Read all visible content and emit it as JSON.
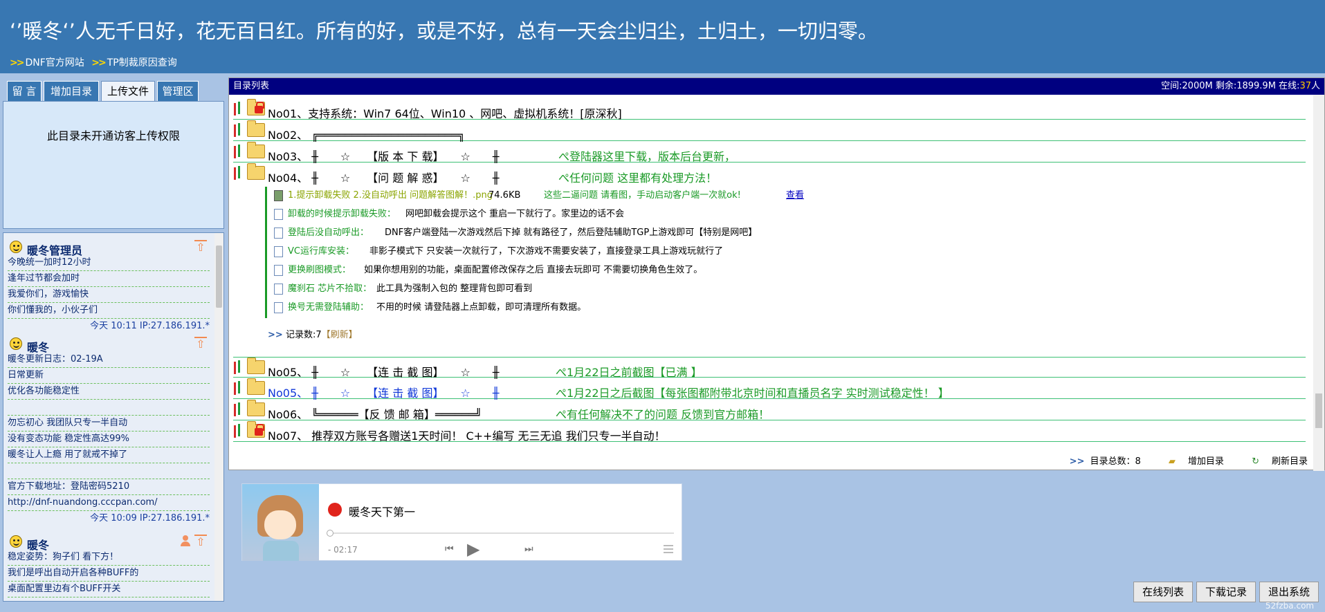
{
  "header": {
    "title": "‘’暖冬‘’人无千日好，花无百日红。所有的好，或是不好，总有一天会尘归尘，土归土，一切归零。",
    "links": [
      ">>DNF官方网站",
      ">>TP制裁原因查询"
    ],
    "link_labels": [
      "DNF官方网站",
      "TP制裁原因查询"
    ],
    "link_arrow": ">>"
  },
  "tabs": [
    "留 言",
    "增加目录",
    "上传文件",
    "管理区"
  ],
  "active_tab": "上传文件",
  "upload": {
    "message": "此目录未开通访客上传权限"
  },
  "messages": [
    {
      "name": "暖冬管理员",
      "lines": [
        "今晚统一加时12小时",
        "逢年过节都会加时",
        "我爱你们，游戏愉快",
        "你们懂我的，小伙子们"
      ],
      "time": "今天 10:11 IP:27.186.191.*"
    },
    {
      "name": "暖冬",
      "lines": [
        "暖冬更新日志：02-19A",
        "日常更新",
        "优化各功能稳定性",
        "",
        "勿忘初心 我团队只专一半自动",
        "没有变态功能 稳定性高达99%",
        "暖冬让人上瘾 用了就戒不掉了",
        "",
        "官方下载地址：登陆密码5210",
        "http://dnf-nuandong.cccpan.com/"
      ],
      "time": "今天 10:09 IP:27.186.191.*"
    },
    {
      "name": "暖冬",
      "lines": [
        "稳定姿势：狗子们 看下方！",
        "我们是呼出自动开启各种BUFF的",
        "桌面配置里边有个BUFF开关"
      ],
      "time": ""
    }
  ],
  "directory": {
    "title": "目录列表",
    "stat_prefix": "空间:2000M 剩余:1899.9M 在线:",
    "online": "37",
    "stat_suffix": "人",
    "rows": [
      {
        "label": "No01、支持系统：Win7 64位、Win10 、网吧、虚拟机系统！[原深秋]",
        "desc": "",
        "locked": true
      },
      {
        "label": "No02、 ╔═════════════════════╗",
        "desc": "",
        "locked": false
      },
      {
        "label": "No03、 ╫　　☆　　【版 本 下 载】　　☆　　╫",
        "desc": "ぺ登陆器这里下载，版本后台更新，",
        "locked": false
      },
      {
        "label": "No04、 ╫　　☆　　【问 题 解 惑】　　☆　　╫",
        "desc": "ぺ任何问题 这里都有处理方法！",
        "locked": false
      },
      {
        "label": "No05、 ╫　　☆　　【连 击 截 图】　　☆　　╫",
        "desc": "ぺ1月22日之前截图【已满 】",
        "locked": false
      },
      {
        "label": "No05、 ╫　　☆　　【连 击 截 图】　　☆　　╫",
        "desc": "ぺ1月22日之后截图【每张图都附带北京时间和直播员名字 实时测试稳定性！ 】",
        "locked": false
      },
      {
        "label": "No06、 ╚══════【反 馈 邮 箱】══════╝",
        "desc": "ぺ有任何解决不了的问题 反馈到官方邮箱！",
        "locked": false
      },
      {
        "label": "No07、 推荐双方账号各赠送1天时间！ C++编写 无三无追 我们只专一半自动！",
        "desc": "",
        "locked": true
      }
    ],
    "files": [
      {
        "name": "1.提示卸载失败 2.没自动呼出 问题解答图解！.png",
        "size": "74.6KB",
        "desc": "这些二逼问题 请看图，手动启动客户端一次就ok!",
        "view": "查看"
      },
      {
        "name": "卸载的时候提示卸载失败：",
        "desc": "网吧卸载会提示这个 重启一下就行了。家里边的话不会"
      },
      {
        "name": "登陆后没自动呼出：",
        "desc": "DNF客户端登陆一次游戏然后下掉 就有路径了，然后登陆辅助TGP上游戏即可【特别是网吧】"
      },
      {
        "name": "VC运行库安装：",
        "desc": "非影子模式下 只安装一次就行了，下次游戏不需要安装了，直接登录工具上游戏玩就行了"
      },
      {
        "name": "更换刷图模式：",
        "desc": "如果你想用别的功能，桌面配置修改保存之后 直接去玩即可 不需要切换角色生效了。"
      },
      {
        "name": "魔刹石 芯片不拾取：",
        "desc": "此工具为强制入包的 整理背包即可看到"
      },
      {
        "name": "换号无需登陆辅助：",
        "desc": "不用的时候 请登陆器上点卸载，即可清理所有数据。"
      }
    ],
    "record_label": "记录数:7",
    "refresh_label": "【刷新】",
    "total_label": "目录总数：8",
    "add_label": "增加目录",
    "refresh_dir_label": "刷新目录"
  },
  "player": {
    "song": "暖冬天下第一",
    "time": "- 02:17"
  },
  "buttons": [
    "在线列表",
    "下载记录",
    "退出系统"
  ],
  "watermark": "52fzba.com"
}
